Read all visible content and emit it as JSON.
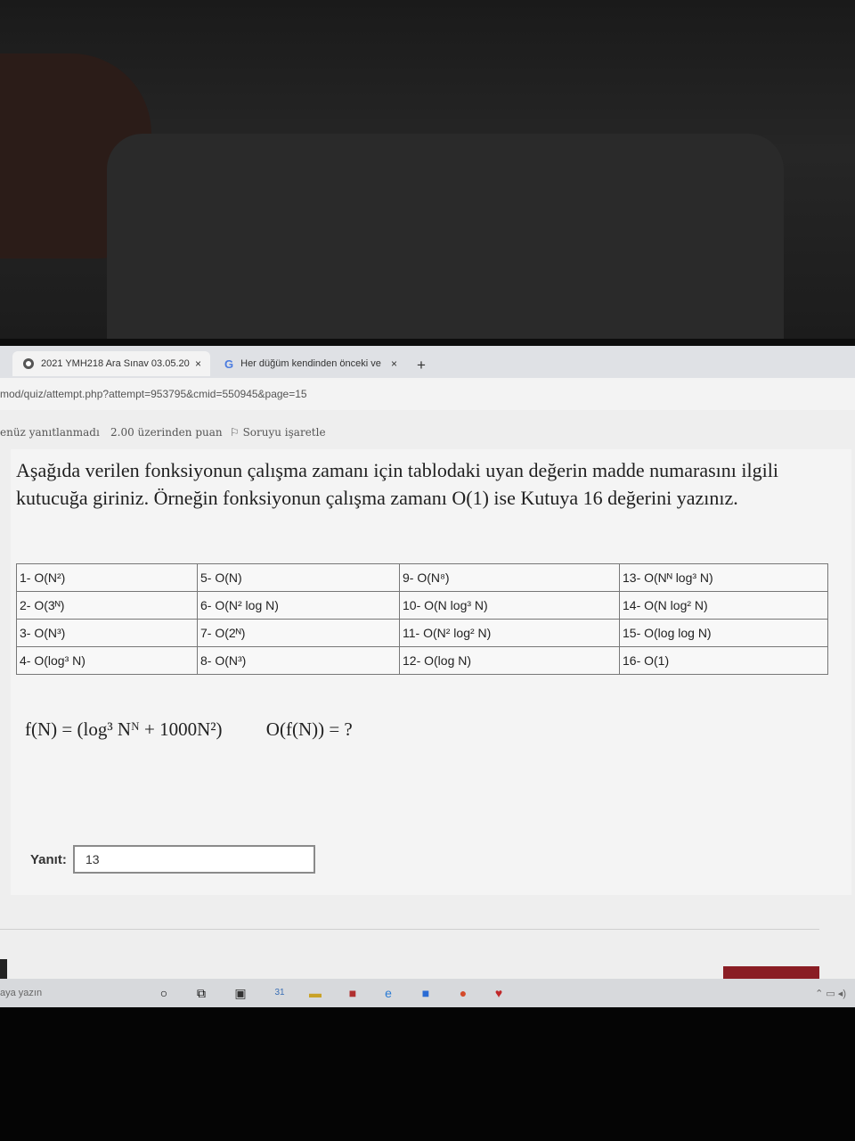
{
  "tabs": [
    {
      "title": "2021 YMH218 Ara Sınav 03.05.20",
      "close": "×"
    },
    {
      "title": "Her düğüm kendinden önceki ve",
      "close": "×"
    }
  ],
  "new_tab": "+",
  "url": "mod/quiz/attempt.php?attempt=953795&cmid=550945&page=15",
  "info": {
    "status": "enüz yanıtlanmadı",
    "points": "2.00 üzerinden puan",
    "flag": "Soruyu işaretle"
  },
  "question": {
    "text": "Aşağıda verilen fonksiyonun çalışma zamanı için tablodaki uyan değerin madde numarasını ilgili kutucuğa giriniz. Örneğin fonksiyonun çalışma zamanı O(1) ise Kutuya 16 değerini yazınız."
  },
  "options": [
    [
      "1- O(N²)",
      "5- O(N)",
      "9- O(N⁸)",
      "13- O(Nᴺ log³ N)"
    ],
    [
      "2- O(3ᴺ)",
      "6- O(N² log N)",
      "10- O(N log³ N)",
      "14- O(N log² N)"
    ],
    [
      "3- O(N³)",
      "7- O(2ᴺ)",
      "11- O(N² log² N)",
      "15- O(log log N)"
    ],
    [
      "4- O(log³ N)",
      "8- O(N³)",
      "12- O(log N)",
      "16- O(1)"
    ]
  ],
  "formula": {
    "function": "f(N) = (log³ Nᴺ + 1000N²)",
    "query": "O(f(N)) = ?"
  },
  "answer": {
    "label": "Yanıt:",
    "value": "13"
  },
  "taskbar": {
    "search_text": "aya yazın",
    "calendar_badge": "31"
  },
  "colors": {
    "next_button": "#8a1d24",
    "tab_bar": "#dfe1e5"
  }
}
